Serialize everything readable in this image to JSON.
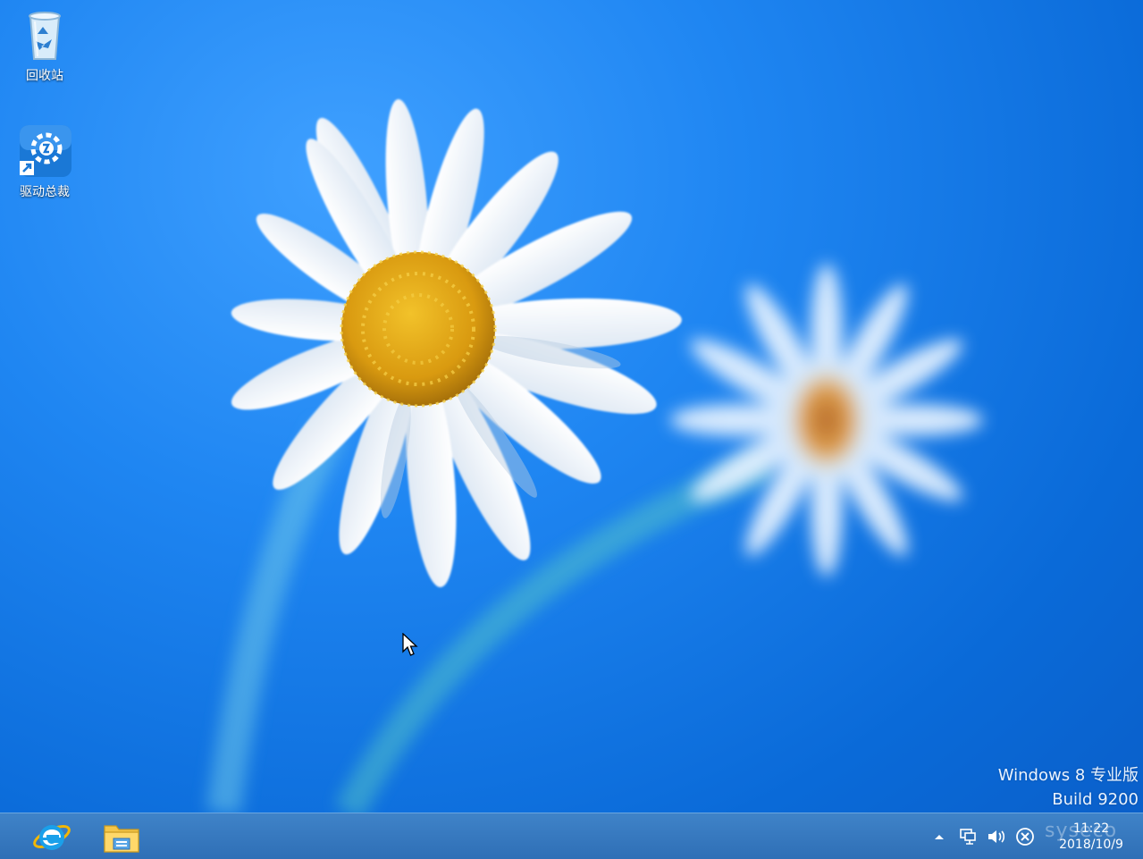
{
  "desktop": {
    "icons": [
      {
        "label": "回收站",
        "icon": "recycle-bin-icon"
      },
      {
        "label": "驱动总裁",
        "icon": "driver-app-icon"
      }
    ],
    "watermark": {
      "edition": "Windows 8 专业版",
      "build": "Build 9200"
    }
  },
  "taskbar": {
    "apps": [
      {
        "name": "Internet Explorer",
        "icon": "internet-explorer-icon"
      },
      {
        "name": "File Explorer",
        "icon": "file-explorer-icon"
      }
    ],
    "tray": {
      "icons": [
        "show-hidden-icons-chevron",
        "network-icon",
        "volume-icon",
        "action-center-icon"
      ],
      "time": "11:22",
      "date": "2018/10/9",
      "overlay_brand": "syseco"
    }
  },
  "colors": {
    "sky": "#1f86f2",
    "taskbar": "#3577bf",
    "petal": "#ffffff",
    "center": "#e8b21c"
  }
}
